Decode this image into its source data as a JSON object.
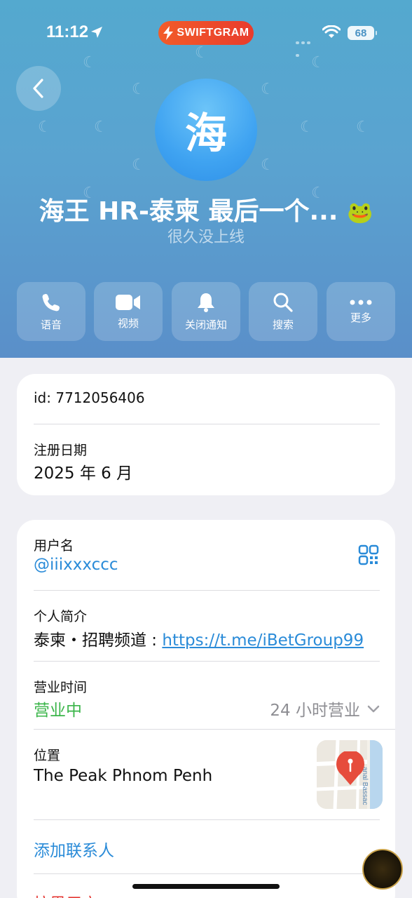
{
  "status_bar": {
    "time": "11:12",
    "app_badge": "SWIFTGRAM",
    "battery": "68"
  },
  "profile": {
    "avatar_letter": "海",
    "name": "海王 HR-泰柬 最后一个...",
    "last_seen": "很久没上线"
  },
  "actions": [
    {
      "label": "语音",
      "icon": "phone-icon"
    },
    {
      "label": "视频",
      "icon": "video-icon"
    },
    {
      "label": "关闭通知",
      "icon": "bell-icon"
    },
    {
      "label": "搜索",
      "icon": "search-icon"
    },
    {
      "label": "更多",
      "icon": "more-icon"
    }
  ],
  "info_card": {
    "id_text": "id: 7712056406",
    "registration_label": "注册日期",
    "registration_value": "2025 年 6 月"
  },
  "details_card": {
    "username_label": "用户名",
    "username_value": "@iiixxxccc",
    "bio_label": "个人简介",
    "bio_prefix": "泰柬・招聘频道 : ",
    "bio_link": "https://t.me/iBetGroup99",
    "hours_label": "营业时间",
    "hours_status": "营业中",
    "hours_detail": "24 小时营业",
    "location_label": "位置",
    "location_value": "The Peak Phnom Penh",
    "map_street": "anal Bassac",
    "add_contact": "添加联系人",
    "block_user": "拉黑用户"
  },
  "colors": {
    "accent": "#2a8bd8",
    "open_green": "#3bb54a",
    "header_top": "#54a9cf",
    "header_bottom": "#5a8fc9"
  }
}
